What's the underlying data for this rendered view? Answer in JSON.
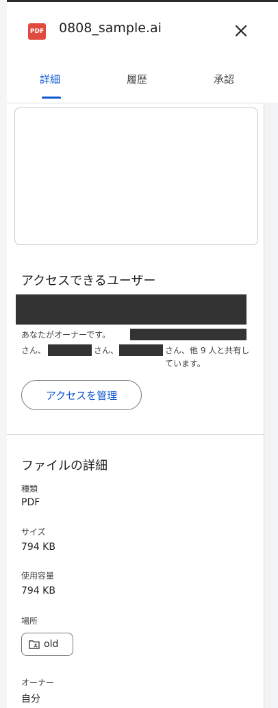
{
  "header": {
    "file_type_badge": "PDF",
    "file_name": "0808_sample.ai"
  },
  "tabs": [
    {
      "label": "詳細",
      "active": true
    },
    {
      "label": "履歴",
      "active": false
    },
    {
      "label": "承認",
      "active": false
    }
  ],
  "access": {
    "title": "アクセスできるユーザー",
    "desc_owner": "あなたがオーナーです。",
    "desc_san1": "さん、",
    "desc_san2": "さん、",
    "desc_rest": "さん、他 9 人と共有しています。",
    "manage_label": "アクセスを管理"
  },
  "details": {
    "title": "ファイルの詳細",
    "type_label": "種類",
    "type_value": "PDF",
    "size_label": "サイズ",
    "size_value": "794 KB",
    "used_label": "使用容量",
    "used_value": "794 KB",
    "location_label": "場所",
    "location_value": "old",
    "owner_label": "オーナー",
    "owner_value": "自分"
  },
  "colors": {
    "accent": "#0b57d0",
    "pdf_badge": "#e04a3f",
    "redaction": "#333333"
  }
}
